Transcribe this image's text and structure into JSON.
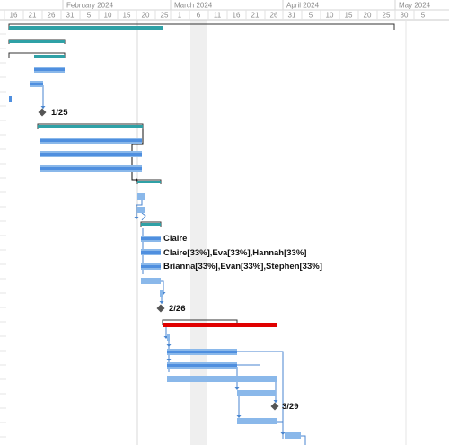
{
  "timescale": {
    "months": [
      "February 2024",
      "March 2024",
      "April 2024",
      "May 2024"
    ],
    "days": [
      "16",
      "21",
      "26",
      "31",
      "5",
      "10",
      "15",
      "20",
      "25",
      "1",
      "6",
      "11",
      "16",
      "21",
      "26",
      "31",
      "5",
      "10",
      "15",
      "20",
      "25",
      "30",
      "5"
    ]
  },
  "milestones": [
    "1/25",
    "2/26",
    "3/29"
  ],
  "resource_labels": [
    "Claire",
    "Claire[33%],Eva[33%],Hannah[33%]",
    "Brianna[33%],Evan[33%],Stephen[33%]"
  ],
  "colors": {
    "summary": "#2fa1a6",
    "task": "#4f8fdf",
    "task_light": "#8ab8ea",
    "critical": "#e00000",
    "link": "#4a86d0",
    "milestone": "#555555",
    "nonworking": "#efefef"
  }
}
